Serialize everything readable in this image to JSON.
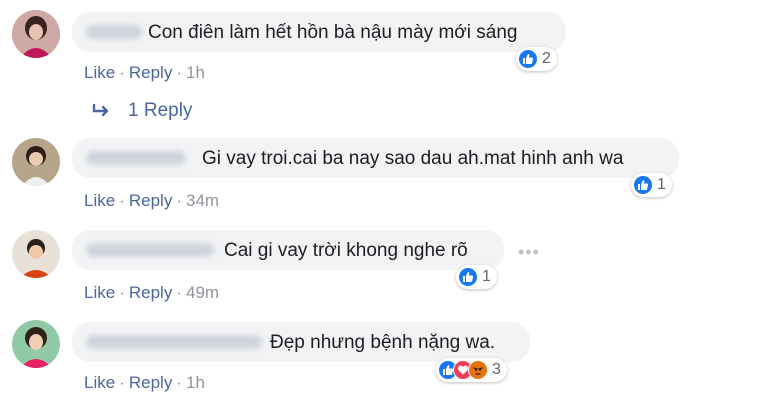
{
  "comments": [
    {
      "text": "Con điên làm hết hồn bà nậu mày mới sáng",
      "actions": {
        "like": "Like",
        "reply": "Reply",
        "time": "1h"
      },
      "reaction_count": "2"
    },
    {
      "text": "Gi vay troi.cai ba nay sao dau ah.mat hinh anh wa",
      "actions": {
        "like": "Like",
        "reply": "Reply",
        "time": "34m"
      },
      "reaction_count": "1"
    },
    {
      "text": "Cai gi vay trời khong nghe rõ",
      "actions": {
        "like": "Like",
        "reply": "Reply",
        "time": "49m"
      },
      "reaction_count": "1"
    },
    {
      "text": "Đẹp nhưng bệnh nặng wa.",
      "actions": {
        "like": "Like",
        "reply": "Reply",
        "time": "1h"
      },
      "reaction_count": "3"
    }
  ],
  "reply_link": "1 Reply",
  "more_glyph": "•••",
  "separator": "·",
  "colors": {
    "link": "#4b67a1",
    "bubble": "#f2f3f5",
    "like_blue": "#1877f2",
    "love_red": "#f33e58",
    "angry_orange": "#e9710f"
  }
}
